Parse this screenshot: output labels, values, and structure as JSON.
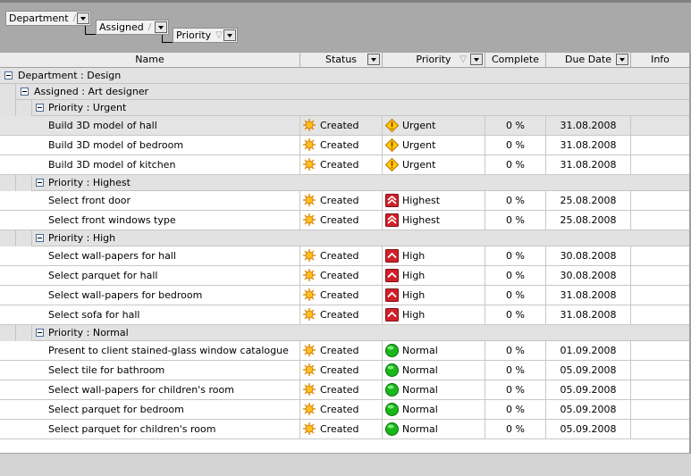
{
  "group_panel": {
    "chips": [
      {
        "label": "Department",
        "sort": "/"
      },
      {
        "label": "Assigned",
        "sort": "/"
      },
      {
        "label": "Priority",
        "sort": "▽"
      }
    ]
  },
  "columns": [
    {
      "label": "Name"
    },
    {
      "label": "Status"
    },
    {
      "label": "Priority",
      "sort": "▽"
    },
    {
      "label": "Complete"
    },
    {
      "label": "Due Date"
    },
    {
      "label": "Info"
    }
  ],
  "groups": {
    "department": "Department : Design",
    "assigned": "Assigned : Art designer",
    "p_urgent": "Priority : Urgent",
    "p_highest": "Priority : Highest",
    "p_high": "Priority : High",
    "p_normal": "Priority : Normal"
  },
  "rows": [
    {
      "name": "Build 3D model of hall",
      "status": "Created",
      "priority": "Urgent",
      "complete": "0 %",
      "due": "31.08.2008"
    },
    {
      "name": "Build 3D model of bedroom",
      "status": "Created",
      "priority": "Urgent",
      "complete": "0 %",
      "due": "31.08.2008"
    },
    {
      "name": "Build 3D model of kitchen",
      "status": "Created",
      "priority": "Urgent",
      "complete": "0 %",
      "due": "31.08.2008"
    },
    {
      "name": "Select front door",
      "status": "Created",
      "priority": "Highest",
      "complete": "0 %",
      "due": "25.08.2008"
    },
    {
      "name": "Select front windows type",
      "status": "Created",
      "priority": "Highest",
      "complete": "0 %",
      "due": "25.08.2008"
    },
    {
      "name": "Select wall-papers for hall",
      "status": "Created",
      "priority": "High",
      "complete": "0 %",
      "due": "30.08.2008"
    },
    {
      "name": "Select parquet for hall",
      "status": "Created",
      "priority": "High",
      "complete": "0 %",
      "due": "30.08.2008"
    },
    {
      "name": "Select wall-papers for bedroom",
      "status": "Created",
      "priority": "High",
      "complete": "0 %",
      "due": "31.08.2008"
    },
    {
      "name": "Select sofa for hall",
      "status": "Created",
      "priority": "High",
      "complete": "0 %",
      "due": "31.08.2008"
    },
    {
      "name": "Present to client stained-glass window catalogue",
      "status": "Created",
      "priority": "Normal",
      "complete": "0 %",
      "due": "01.09.2008"
    },
    {
      "name": "Select tile for bathroom",
      "status": "Created",
      "priority": "Normal",
      "complete": "0 %",
      "due": "05.09.2008"
    },
    {
      "name": "Select wall-papers for children's room",
      "status": "Created",
      "priority": "Normal",
      "complete": "0 %",
      "due": "05.09.2008"
    },
    {
      "name": "Select parquet for bedroom",
      "status": "Created",
      "priority": "Normal",
      "complete": "0 %",
      "due": "05.09.2008"
    },
    {
      "name": "Select parquet for children's room",
      "status": "Created",
      "priority": "Normal",
      "complete": "0 %",
      "due": "05.09.2008"
    }
  ]
}
